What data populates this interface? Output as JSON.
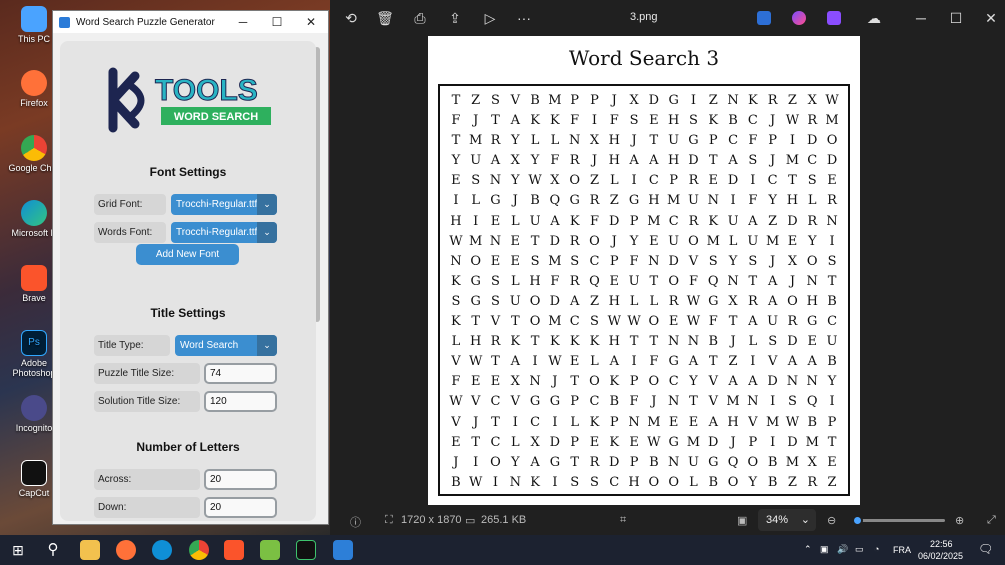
{
  "desktop": {
    "icons": [
      {
        "label": "This PC",
        "icon": "computer-icon",
        "color": "#4aa3ff"
      },
      {
        "label": "Firefox",
        "icon": "firefox-icon",
        "color": "#ff7139"
      },
      {
        "label": "Google Chro",
        "icon": "chrome-icon",
        "color": "#34a853"
      },
      {
        "label": "Microsoft E",
        "icon": "edge-icon",
        "color": "#0f8fd6"
      },
      {
        "label": "Brave",
        "icon": "brave-icon",
        "color": "#fb542b"
      },
      {
        "label": "Adobe Photoshop",
        "icon": "photoshop-icon",
        "color": "#001e36"
      },
      {
        "label": "Incognito",
        "icon": "incognito-icon",
        "color": "#4a4a8a"
      },
      {
        "label": "CapCut",
        "icon": "capcut-icon",
        "color": "#111111"
      }
    ]
  },
  "app": {
    "title": "Word Search Puzzle Generator",
    "logo": {
      "text": "TOOLS",
      "banner": "WORD SEARCH"
    },
    "font_settings": {
      "heading": "Font Settings",
      "grid_font_label": "Grid Font:",
      "grid_font_value": "Trocchi-Regular.ttf",
      "words_font_label": "Words Font:",
      "words_font_value": "Trocchi-Regular.ttf",
      "add_font": "Add New Font"
    },
    "title_settings": {
      "heading": "Title Settings",
      "title_type_label": "Title Type:",
      "title_type_value": "Word Search",
      "puzzle_title_size_label": "Puzzle Title Size:",
      "puzzle_title_size_value": "74",
      "solution_title_size_label": "Solution Title Size:",
      "solution_title_size_value": "120"
    },
    "letters": {
      "heading": "Number of Letters",
      "across_label": "Across:",
      "across_value": "20",
      "down_label": "Down:",
      "down_value": "20"
    },
    "accent": "#3b8ed0"
  },
  "viewer": {
    "filename": "3.png",
    "puzzle_title": "Word Search 3",
    "grid": [
      "TZSVBMPPJXDGIZNKRZXW",
      "FJTAKKFIFSEHSKBCJWRM",
      "TMRYLLNXHJTUGPCFPIDO",
      "YUAXYFRJHAAHDTASJMCD",
      "ESNYWXOZLICPREDICTSE",
      "ILGJBQGRZGHMUNIFYHLR",
      "HIELUAKFDPMCRKUAZDRN",
      "WMNETDROJYEUOMLUMEYI",
      "NOEESMSCPFNDVSYSJXOS",
      "KGSLHFRQEUTOFQNTAJNT",
      "SGSUODAZHLLRWGXRAOHB",
      "KTVTOMCSWWOEWFTAURGC",
      "LHRKTKKKHTTNNBJLSDEU",
      "VWTAIWELAIFGATZIVAAB",
      "FEEXNJTOKPOCYVAADNNY",
      "WVCVGGPCBFJNTVMNISQI",
      "VJTICILKPNMEEAHVMWBP",
      "ETCLXDPEKEWGMDJPIDMT",
      "JIOYAGTRDPBNUGQOBMXE",
      "BWINKISSCHOOLBOYBZRZ"
    ],
    "dimensions": "1720 x 1870",
    "filesize": "265.1 KB",
    "zoom": "34%",
    "zoom_fraction": 0.1
  },
  "taskbar": {
    "language": "FRA",
    "time": "22:56",
    "date": "06/02/2025",
    "background": "#1c2230"
  }
}
